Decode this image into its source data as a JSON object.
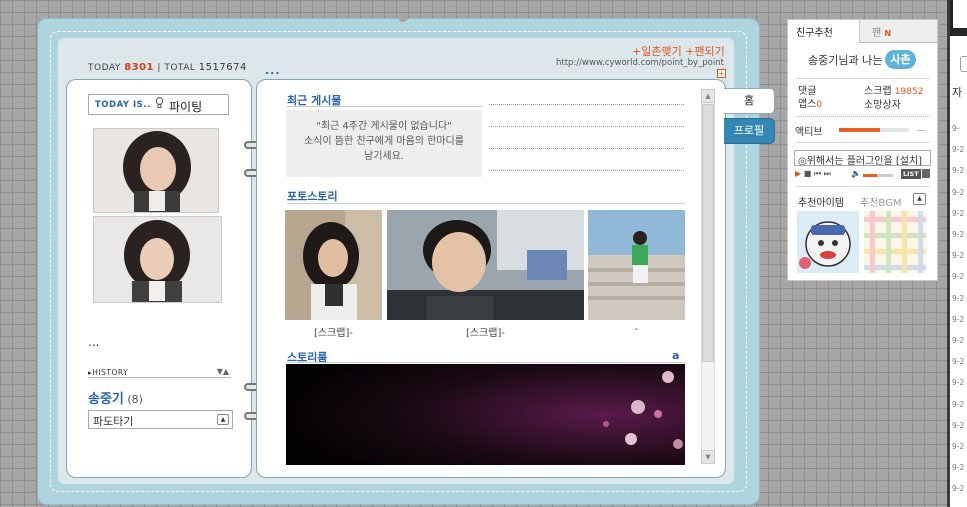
{
  "counter": {
    "today_label": "TODAY",
    "today_value": "8301",
    "separator": "|",
    "total_label": "TOTAL",
    "total_value": "1517674"
  },
  "header": {
    "link_ilchon": "일촌맺기",
    "link_fan": "팬되기",
    "url": "http://www.cyworld.com/point_by_point",
    "more_dots": "...",
    "plus": "+"
  },
  "left": {
    "today_is_label": "TODAY IS..",
    "mood": "파이팅",
    "dots": "...",
    "history_label": "HISTORY",
    "history_toggle": "▼▲",
    "owner_name": "송중기",
    "owner_count": "(8)",
    "select_value": "파도타기"
  },
  "recent": {
    "title": "최근 게시물",
    "message_lines": [
      "\"최근 4주간 게시물이 없습니다\"",
      "소식이 뜸한 친구에게 마음의 한마디를",
      "남기세요."
    ]
  },
  "photo_story": {
    "title": "포토스토리",
    "captions": [
      "[스크랩]-",
      "[스크랩]-",
      "-"
    ]
  },
  "story_room": {
    "title": "스토리룸",
    "tag": "a"
  },
  "tabs": {
    "home": "홈",
    "profile": "프로필"
  },
  "widget": {
    "tab_recommend": "친구추천",
    "tab_fan": "팬",
    "tab_fan_badge": "N",
    "friend_text": "송중기님과 나는",
    "friend_badge": "사촌",
    "comments_label": "댓글",
    "apps_label": "앱스",
    "apps_value": "0",
    "scrap_label": "스크랩",
    "scrap_value": "19852",
    "shop_label": "소망상자",
    "active_label": "액티브",
    "active_level": 0.58,
    "player_text": "◎위해서는 플러그인을 [설치]",
    "list_label": "LIST",
    "rec_item_label": "추천아이템",
    "rec_bgm_label": "추천BGM"
  },
  "far_right": {
    "letter": "자",
    "date_prefixes": [
      "9-",
      "9-2",
      "9-2",
      "9-2",
      "9-2",
      "9-2",
      "9-2",
      "9-2",
      "9-2",
      "9-2",
      "9-2",
      "9-2",
      "9-2",
      "9-2",
      "9-2",
      "9-2",
      "9-2",
      "9-2"
    ]
  },
  "colors": {
    "accent_blue": "#2b64a8",
    "accent_orange": "#e0551a",
    "book_frame": "#aed4de",
    "profile_tab": "#3487b4",
    "friend_badge": "#5fb3d8"
  }
}
